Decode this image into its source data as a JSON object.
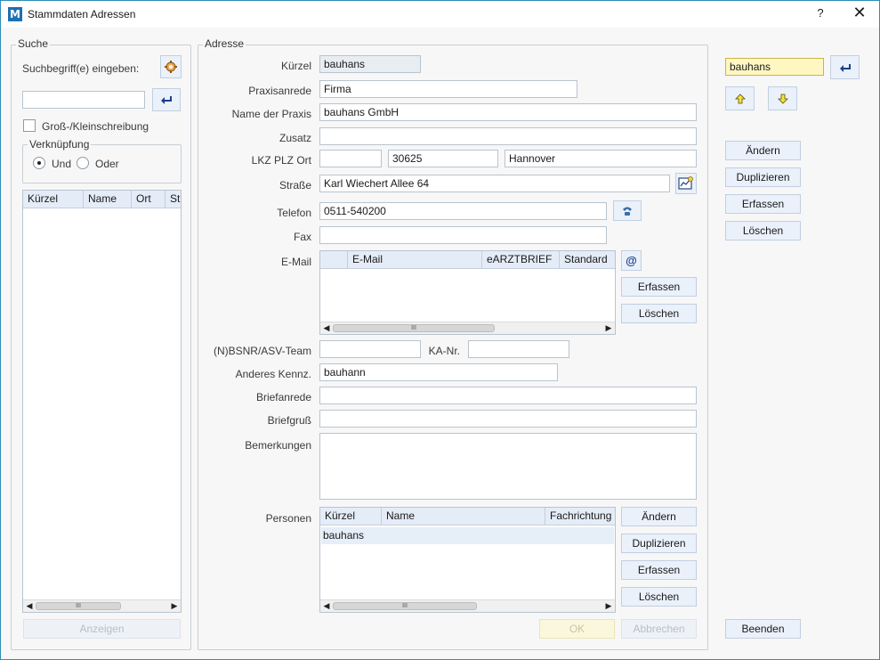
{
  "window": {
    "title": "Stammdaten Adressen",
    "help": "?",
    "close": "✕"
  },
  "suche": {
    "legend": "Suche",
    "prompt": "Suchbegriff(e) eingeben:",
    "input_value": "",
    "case_label": "Groß-/Kleinschreibung",
    "verknuepfung_legend": "Verknüpfung",
    "und_label": "Und",
    "oder_label": "Oder",
    "columns": [
      "Kürzel",
      "Name",
      "Ort",
      "St"
    ],
    "anzeigen_label": "Anzeigen"
  },
  "adresse": {
    "legend": "Adresse",
    "kuerzel_label": "Kürzel",
    "kuerzel_value": "bauhans",
    "praxisanrede_label": "Praxisanrede",
    "praxisanrede_value": "Firma",
    "name_label": "Name der Praxis",
    "name_value": "bauhans GmbH",
    "zusatz_label": "Zusatz",
    "zusatz_value": "",
    "lkz_label": "LKZ PLZ Ort",
    "lkz_value": "",
    "plz_value": "30625",
    "ort_value": "Hannover",
    "strasse_label": "Straße",
    "strasse_value": "Karl Wiechert Allee 64",
    "telefon_label": "Telefon",
    "telefon_value": "0511-540200",
    "fax_label": "Fax",
    "fax_value": "",
    "email_label": "E-Mail",
    "email_columns": [
      "E-Mail",
      "eARZTBRIEF",
      "Standard"
    ],
    "email_erfassen": "Erfassen",
    "email_loeschen": "Löschen",
    "bsnr_label": "(N)BSNR/ASV-Team",
    "bsnr_value": "",
    "kanr_label": "KA-Nr.",
    "kanr_value": "",
    "kennz_label": "Anderes Kennz.",
    "kennz_value": "bauhann",
    "briefanrede_label": "Briefanrede",
    "briefanrede_value": "",
    "briefgruss_label": "Briefgruß",
    "briefgruss_value": "",
    "bemerkungen_label": "Bemerkungen",
    "bemerkungen_value": "",
    "personen_label": "Personen",
    "personen_columns": [
      "Kürzel",
      "Name",
      "Fachrichtung"
    ],
    "personen_rows": [
      {
        "kuerzel": "bauhans",
        "name": "",
        "fachrichtung": ""
      }
    ],
    "personen_aendern": "Ändern",
    "personen_duplizieren": "Duplizieren",
    "personen_erfassen": "Erfassen",
    "personen_loeschen": "Löschen",
    "ok_label": "OK",
    "abbrechen_label": "Abbrechen"
  },
  "right": {
    "search_value": "bauhans",
    "aendern": "Ändern",
    "duplizieren": "Duplizieren",
    "erfassen": "Erfassen",
    "loeschen": "Löschen",
    "beenden": "Beenden"
  },
  "scroll_glyph": "III",
  "colors": {
    "accent": "#2b8fb8",
    "button_bg": "#eaf1fb",
    "highlight": "#fff7c2",
    "header_bg": "#e4ecf7"
  }
}
